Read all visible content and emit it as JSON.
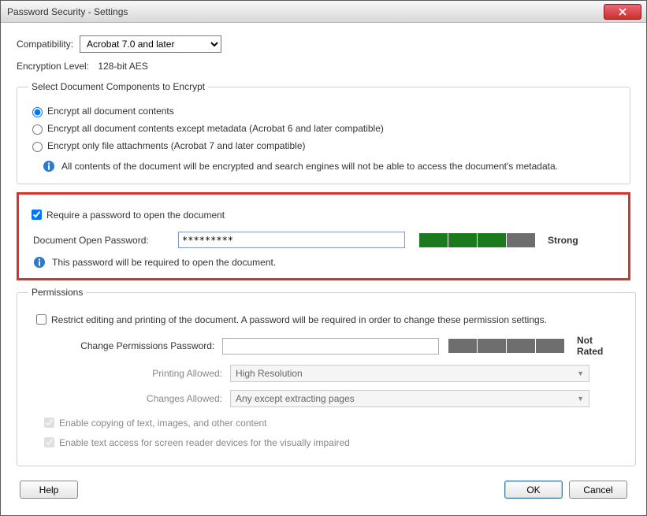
{
  "titlebar": {
    "title": "Password Security - Settings",
    "close_x": "✕"
  },
  "compatibility": {
    "label": "Compatibility:",
    "value": "Acrobat 7.0 and later"
  },
  "encryption": {
    "label": "Encryption Level:",
    "value": "128-bit AES"
  },
  "encrypt_group": {
    "legend": "Select Document Components to Encrypt",
    "opt_all": "Encrypt all document contents",
    "opt_except_meta": "Encrypt all document contents except metadata (Acrobat 6 and later compatible)",
    "opt_attachments": "Encrypt only file attachments (Acrobat 7 and later compatible)",
    "info": "All contents of the document will be encrypted and search engines will not be able to access the document's metadata."
  },
  "open_pwd": {
    "require_label": "Require a password to open the document",
    "field_label": "Document Open Password:",
    "value": "*********",
    "strength": "Strong",
    "info": "This password will be required to open the document."
  },
  "permissions": {
    "legend": "Permissions",
    "restrict_label": "Restrict editing and printing of the document. A password will be required in order to change these permission settings.",
    "change_pwd_label": "Change Permissions Password:",
    "change_pwd_value": "",
    "rating": "Not Rated",
    "printing_label": "Printing Allowed:",
    "printing_value": "High Resolution",
    "changes_label": "Changes Allowed:",
    "changes_value": "Any except extracting pages",
    "enable_copy": "Enable copying of text, images, and other content",
    "enable_screen_reader": "Enable text access for screen reader devices for the visually impaired"
  },
  "buttons": {
    "help": "Help",
    "ok": "OK",
    "cancel": "Cancel"
  }
}
